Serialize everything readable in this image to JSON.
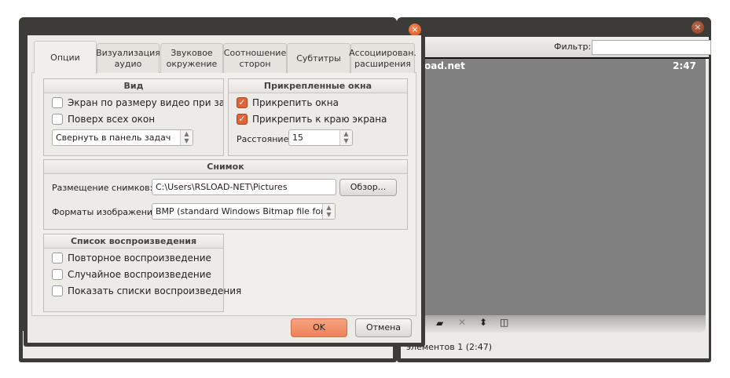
{
  "dialog": {
    "tabs": [
      {
        "label": "Опции"
      },
      {
        "label": "Визуализация аудио"
      },
      {
        "label": "Звуковое окружение"
      },
      {
        "label": "Соотношение сторон"
      },
      {
        "label": "Субтитры"
      },
      {
        "label": "Ассоциирован. расширения"
      }
    ],
    "view": {
      "title": "Вид",
      "fit_video": {
        "label": "Экран по размеру видео при запус",
        "checked": false
      },
      "on_top": {
        "label": "Поверх всех окон",
        "checked": false
      },
      "minimize_combo": "Свернуть в панель задач"
    },
    "docked": {
      "title": "Прикрепленные окна",
      "dock_windows": {
        "label": "Прикрепить окна",
        "checked": true
      },
      "dock_edge": {
        "label": "Прикрепить к краю экрана",
        "checked": true
      },
      "distance_label": "Расстояние:",
      "distance_value": "15"
    },
    "snapshot": {
      "title": "Снимок",
      "location_label": "Размещение снимков:",
      "location_value": "C:\\Users\\RSLOAD-NET\\Pictures",
      "browse": "Обзор...",
      "format_label": "Форматы изображений:",
      "format_value": "BMP (standard Windows Bitmap file format)"
    },
    "playlist": {
      "title": "Список воспроизведения",
      "repeat": {
        "label": "Повторное воспроизведение",
        "checked": false
      },
      "shuffle": {
        "label": "Случайное воспроизведение",
        "checked": false
      },
      "show": {
        "label": "Показать списки воспроизведения",
        "checked": false
      }
    },
    "ok": "OK",
    "cancel": "Отмена"
  },
  "playlist_window": {
    "filter_label": "Фильтр:",
    "filter_value": "",
    "item_title": "oad.net",
    "item_duration": "2:47",
    "status": "элементов 1 (2:47)"
  }
}
